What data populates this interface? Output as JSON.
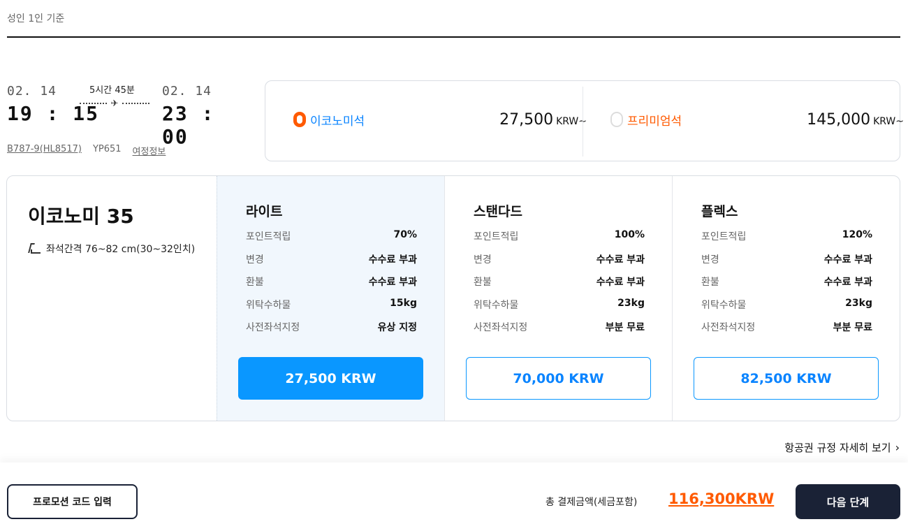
{
  "header": {
    "subtitle": "성인 1인 기준"
  },
  "flight": {
    "departure": {
      "date": "02. 14",
      "time": "19 : 15"
    },
    "arrival": {
      "date": "02. 14",
      "time": "23 : 00"
    },
    "duration": "5시간 45분",
    "aircraft": "B787-9(HL8517)",
    "flight_no": "YP651",
    "itinerary_link": "여정정보"
  },
  "cabin_select": {
    "economy": {
      "label": "이코노미석",
      "price": "27,500",
      "currency": "KRW~",
      "selected": true
    },
    "premium": {
      "label": "프리미엄석",
      "price": "145,000",
      "currency": "KRW~",
      "selected": false
    }
  },
  "cabin": {
    "title": "이코노미 35",
    "seat_pitch": "좌석간격 76~82 cm(30~32인치)"
  },
  "fares": [
    {
      "name": "라이트",
      "rows": [
        {
          "k": "포인트적립",
          "v": "70%"
        },
        {
          "k": "변경",
          "v": "수수료 부과"
        },
        {
          "k": "환불",
          "v": "수수료 부과"
        },
        {
          "k": "위탁수하물",
          "v": "15kg"
        },
        {
          "k": "사전좌석지정",
          "v": "유상 지정"
        }
      ],
      "price": "27,500 KRW",
      "selected": true
    },
    {
      "name": "스탠다드",
      "rows": [
        {
          "k": "포인트적립",
          "v": "100%"
        },
        {
          "k": "변경",
          "v": "수수료 부과"
        },
        {
          "k": "환불",
          "v": "수수료 부과"
        },
        {
          "k": "위탁수하물",
          "v": "23kg"
        },
        {
          "k": "사전좌석지정",
          "v": "부분 무료"
        }
      ],
      "price": "70,000 KRW",
      "selected": false
    },
    {
      "name": "플렉스",
      "rows": [
        {
          "k": "포인트적립",
          "v": "120%"
        },
        {
          "k": "변경",
          "v": "수수료 부과"
        },
        {
          "k": "환불",
          "v": "수수료 부과"
        },
        {
          "k": "위탁수하물",
          "v": "23kg"
        },
        {
          "k": "사전좌석지정",
          "v": "부분 무료"
        }
      ],
      "price": "82,500 KRW",
      "selected": false
    }
  ],
  "rules_link": "항공권 규정 자세히 보기",
  "footer": {
    "promo_label": "프로모션 코드 입력",
    "total_label": "총 결제금액(세금포함)",
    "total_value": "116,300KRW",
    "next_label": "다음 단계"
  },
  "colors": {
    "accent": "#0a97ff",
    "orange": "#ff5a00",
    "navy": "#1a2236"
  }
}
